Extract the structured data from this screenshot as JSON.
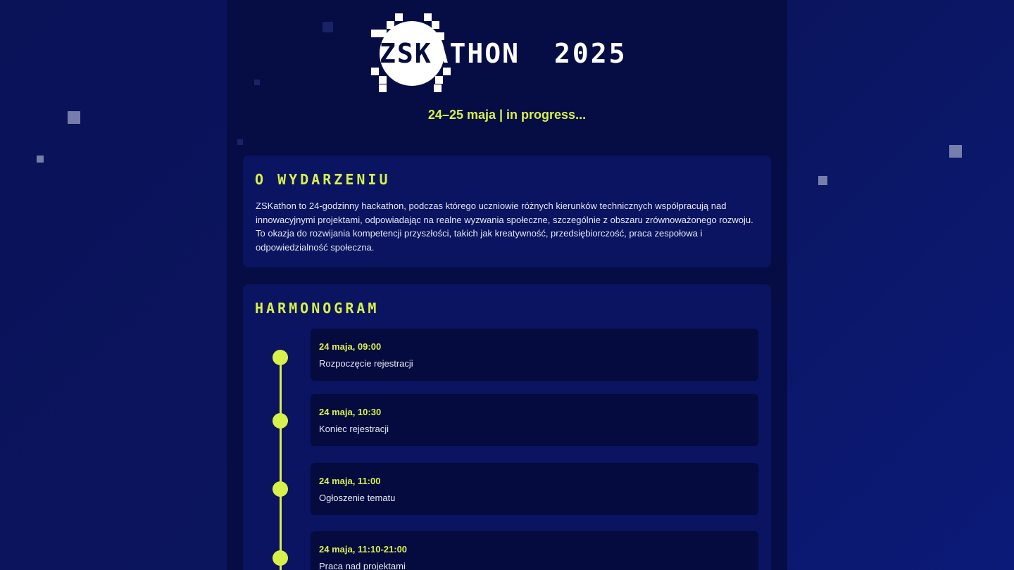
{
  "header": {
    "logo_text_dark": "ZSK",
    "logo_text_light": "ATHON",
    "year": "2025",
    "subtitle": "24–25 maja | in progress..."
  },
  "about": {
    "title": "O WYDARZENIU",
    "text": "ZSKathon to 24-godzinny hackathon, podczas którego uczniowie różnych kierunków technicznych współpracują nad innowacyjnymi projektami, odpowiadając na realne wyzwania społeczne, szczególnie z obszaru zrównoważonego rozwoju. To okazja do rozwijania kompetencji przyszłości, takich jak kreatywność, przedsiębiorczość, praca zespołowa i odpowiedzialność społeczna."
  },
  "schedule": {
    "title": "HARMONOGRAM",
    "items": [
      {
        "time": "24 maja, 09:00",
        "desc": "Rozpoczęcie rejestracji"
      },
      {
        "time": "24 maja, 10:30",
        "desc": "Koniec rejestracji"
      },
      {
        "time": "24 maja, 11:00",
        "desc": "Ogłoszenie tematu"
      },
      {
        "time": "24 maja, 11:10-21:00",
        "desc": "Praca nad projektami"
      }
    ]
  },
  "colors": {
    "accent": "#d8f04a",
    "background": "#0a1258",
    "card": "#0a1460",
    "item": "#050b3e"
  }
}
